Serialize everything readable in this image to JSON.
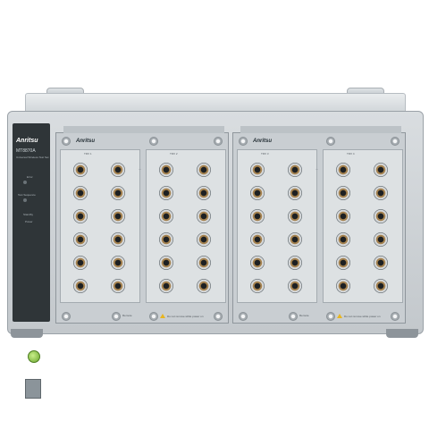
{
  "instrument": {
    "brand": "Anritsu",
    "model": "MT8870A",
    "subtitle": "Universal Wireless Test Set",
    "modules": [
      {
        "brand": "Anritsu",
        "sections": [
          {
            "title": "TRX 1"
          },
          {
            "title": "TRX 2"
          }
        ],
        "remote_label": "Remote",
        "warning_label": "Do not remove while power on"
      },
      {
        "brand": "Anritsu",
        "sections": [
          {
            "title": "TRX 3"
          },
          {
            "title": "TRX 4"
          }
        ],
        "remote_label": "Remote",
        "warning_label": "Do not remove while power on"
      }
    ],
    "controller_labels": {
      "error": "Error",
      "test_sequence": "Test Sequence",
      "standby": "Standby",
      "power": "Power"
    },
    "colors": {
      "chassis": "#cfd4d8",
      "controller_panel": "#2f3538",
      "power_button": "#8bd14a",
      "connector_ring": "#a5824f"
    }
  }
}
